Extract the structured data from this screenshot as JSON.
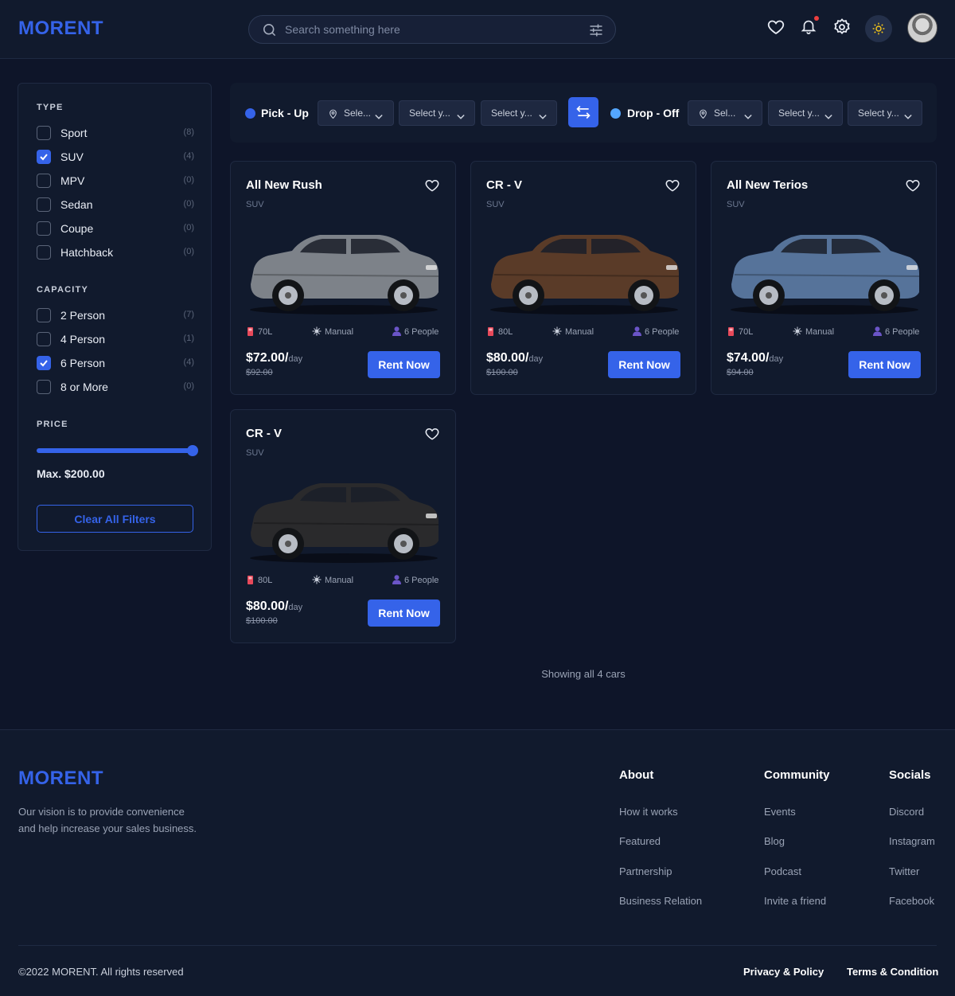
{
  "header": {
    "logo": "MORENT",
    "search_placeholder": "Search something here",
    "icons": [
      "heart-icon",
      "bell-icon",
      "gear-icon",
      "sun-icon"
    ]
  },
  "sidebar": {
    "type_title": "TYPE",
    "types": [
      {
        "label": "Sport",
        "count": "(8)",
        "checked": false
      },
      {
        "label": "SUV",
        "count": "(4)",
        "checked": true
      },
      {
        "label": "MPV",
        "count": "(0)",
        "checked": false
      },
      {
        "label": "Sedan",
        "count": "(0)",
        "checked": false
      },
      {
        "label": "Coupe",
        "count": "(0)",
        "checked": false
      },
      {
        "label": "Hatchback",
        "count": "(0)",
        "checked": false
      }
    ],
    "capacity_title": "CAPACITY",
    "capacities": [
      {
        "label": "2 Person",
        "count": "(7)",
        "checked": false
      },
      {
        "label": "4 Person",
        "count": "(1)",
        "checked": false
      },
      {
        "label": "6 Person",
        "count": "(4)",
        "checked": true
      },
      {
        "label": "8 or More",
        "count": "(0)",
        "checked": false
      }
    ],
    "price_title": "PRICE",
    "price_level": 1.0,
    "max_price": "Max. $200.00",
    "clear_label": "Clear All Filters"
  },
  "pickup": {
    "label": "Pick - Up",
    "location": "Sele...",
    "date": "Select y...",
    "time": "Select y..."
  },
  "dropoff": {
    "label": "Drop - Off",
    "location": "Sel...",
    "date": "Select y...",
    "time": "Select y..."
  },
  "cars": [
    {
      "name": "All New Rush",
      "type": "SUV",
      "fuel": "70L",
      "transmission": "Manual",
      "capacity": "6 People",
      "price": "$72.00/",
      "per": "day",
      "old_price": "$92.00",
      "cta": "Rent Now",
      "color": "#7d8289"
    },
    {
      "name": "CR - V",
      "type": "SUV",
      "fuel": "80L",
      "transmission": "Manual",
      "capacity": "6 People",
      "price": "$80.00/",
      "per": "day",
      "old_price": "$100.00",
      "cta": "Rent Now",
      "color": "#5a3b28"
    },
    {
      "name": "All New Terios",
      "type": "SUV",
      "fuel": "70L",
      "transmission": "Manual",
      "capacity": "6 People",
      "price": "$74.00/",
      "per": "day",
      "old_price": "$94.00",
      "cta": "Rent Now",
      "color": "#56739a"
    },
    {
      "name": "CR - V",
      "type": "SUV",
      "fuel": "80L",
      "transmission": "Manual",
      "capacity": "6 People",
      "price": "$80.00/",
      "per": "day",
      "old_price": "$100.00",
      "cta": "Rent Now",
      "color": "#2a2a2c"
    }
  ],
  "showing_text": "Showing all 4 cars",
  "footer": {
    "logo": "MORENT",
    "vision": "Our vision is to provide convenience and help increase your sales business.",
    "about": {
      "title": "About",
      "links": [
        "How it works",
        "Featured",
        "Partnership",
        "Business Relation"
      ]
    },
    "community": {
      "title": "Community",
      "links": [
        "Events",
        "Blog",
        "Podcast",
        "Invite a friend"
      ]
    },
    "socials": {
      "title": "Socials",
      "links": [
        "Discord",
        "Instagram",
        "Twitter",
        "Facebook"
      ]
    },
    "copyright": "©2022 MORENT. All rights reserved",
    "privacy": "Privacy & Policy",
    "terms": "Terms & Condition"
  },
  "colors": {
    "accent": "#3563e9",
    "background": "#0e1529",
    "panel": "#111a2d",
    "dropoff_dot": "#54a6ff"
  }
}
